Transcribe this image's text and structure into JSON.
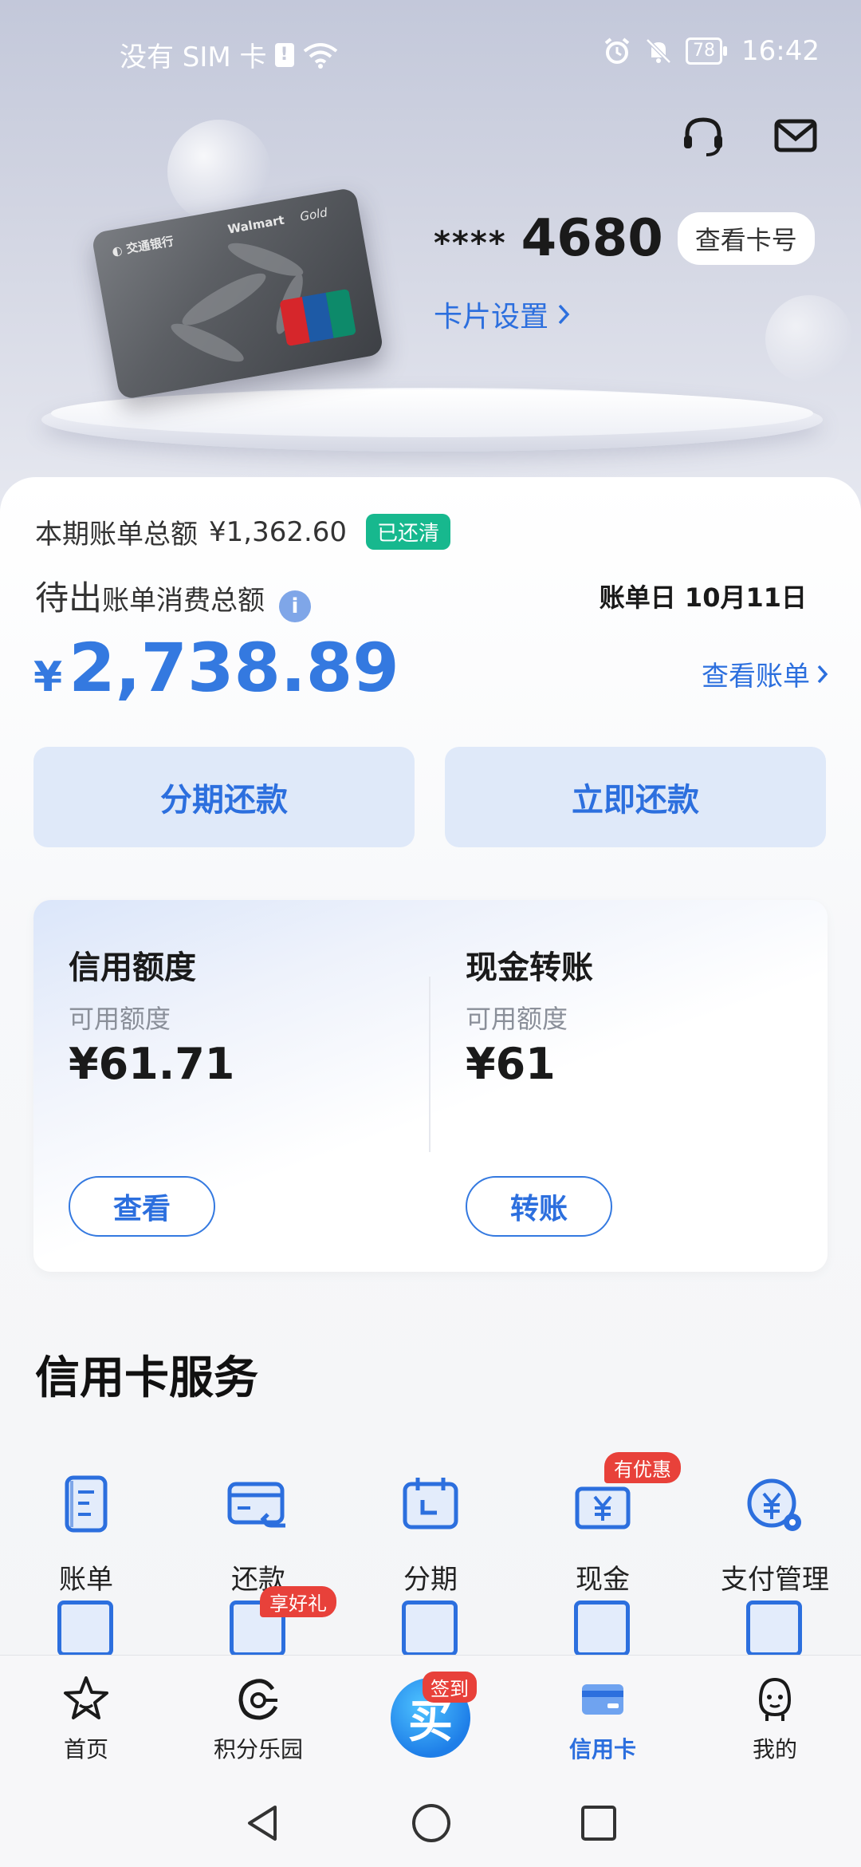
{
  "status_bar": {
    "carrier": "没有 SIM 卡",
    "battery": "78",
    "time": "16:42"
  },
  "card": {
    "stars": "****",
    "last4": "4680",
    "view_number_label": "查看卡号",
    "settings_label": "卡片设置",
    "image_brand_text": "Walmart",
    "image_tier_text": "Gold",
    "image_network_text": "UnionPay 银联"
  },
  "bill": {
    "current_label": "本期账单总额",
    "current_amount": "¥1,362.60",
    "paid_badge": "已还清",
    "pending_big": "待出",
    "pending_small": "账单消费总额",
    "bill_date": "账单日 10月11日",
    "amount_currency": "¥",
    "amount_value": "2,738.89",
    "view_bill_label": "查看账单"
  },
  "actions": {
    "installment_label": "分期还款",
    "repay_now_label": "立即还款"
  },
  "credit": {
    "limit_title": "信用额度",
    "limit_sub": "可用额度",
    "limit_value": "¥61.71",
    "limit_button": "查看",
    "cash_title": "现金转账",
    "cash_sub": "可用额度",
    "cash_value": "¥61",
    "cash_button": "转账"
  },
  "services": {
    "title": "信用卡服务",
    "items": [
      {
        "label": "账单",
        "icon": "bill-icon"
      },
      {
        "label": "还款",
        "icon": "repay-icon"
      },
      {
        "label": "分期",
        "icon": "calendar-icon"
      },
      {
        "label": "现金",
        "icon": "cash-icon",
        "tag": "有优惠"
      },
      {
        "label": "支付管理",
        "icon": "payment-settings-icon"
      }
    ],
    "row2_tag": "享好礼"
  },
  "bottom_nav": {
    "items": [
      {
        "label": "首页",
        "icon": "star-icon"
      },
      {
        "label": "积分乐园",
        "icon": "points-icon"
      },
      {
        "label": "",
        "icon": "checkin-icon"
      },
      {
        "label": "信用卡",
        "icon": "credit-card-icon"
      },
      {
        "label": "我的",
        "icon": "profile-icon"
      }
    ],
    "center_tag": "签到",
    "active_color": "#2c6fde"
  },
  "colors": {
    "accent": "#3479e0",
    "paid_badge": "#17b88e",
    "promo_tag": "#e8413a"
  }
}
